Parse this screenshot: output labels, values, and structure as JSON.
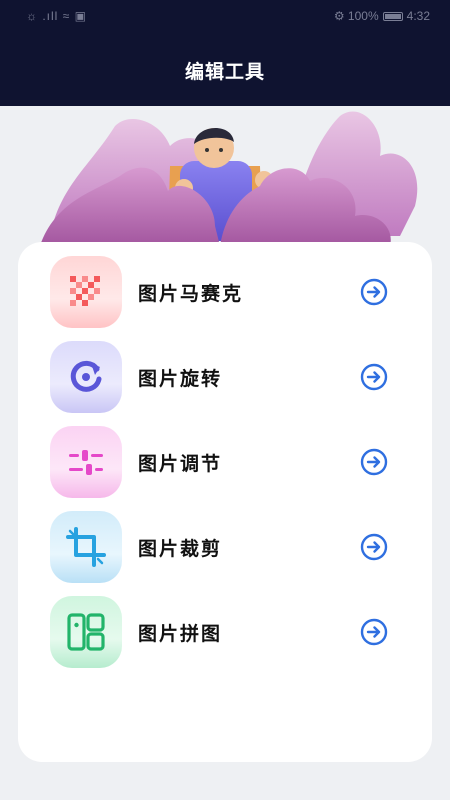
{
  "status_bar": {
    "left": "☼ .ıll ≈ ▣",
    "right": "⚙ 100%",
    "time": "4:32"
  },
  "header": {
    "title": "编辑工具"
  },
  "tools": [
    {
      "label": "图片马赛克",
      "icon": "mosaic-icon",
      "color": "#f4595b"
    },
    {
      "label": "图片旋转",
      "icon": "rotate-icon",
      "color": "#5a56d8"
    },
    {
      "label": "图片调节",
      "icon": "adjust-icon",
      "color": "#e548c9"
    },
    {
      "label": "图片裁剪",
      "icon": "crop-icon",
      "color": "#27a2e0"
    },
    {
      "label": "图片拼图",
      "icon": "collage-icon",
      "color": "#22b46a"
    }
  ],
  "colors": {
    "header_bg": "#0f1330",
    "arrow": "#2f6fe0",
    "page_bg": "#eef0f3"
  }
}
